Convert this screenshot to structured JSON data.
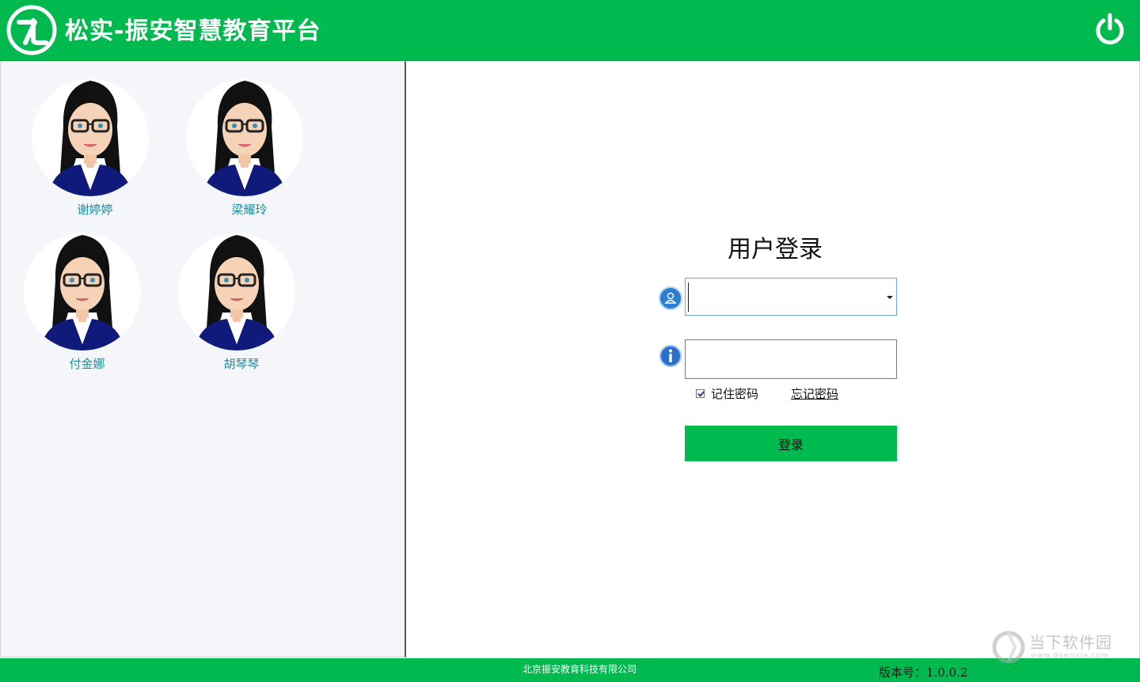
{
  "header": {
    "title": "松实-振安智慧教育平台",
    "brand_color": "#00b94f"
  },
  "users": [
    {
      "name": "谢婷婷",
      "avatar_icon": "female-teacher-avatar"
    },
    {
      "name": "梁耀玲",
      "avatar_icon": "female-teacher-avatar"
    },
    {
      "name": "付金娜",
      "avatar_icon": "female-teacher-avatar"
    },
    {
      "name": "胡琴琴",
      "avatar_icon": "female-teacher-avatar"
    }
  ],
  "login": {
    "title": "用户登录",
    "username_value": "",
    "password_value": "",
    "remember_label": "记住密码",
    "remember_checked": true,
    "forgot_label": "忘记密码",
    "submit_label": "登录"
  },
  "footer": {
    "company": "北京振安教育科技有限公司",
    "version": "版本号：1.0.0.2"
  },
  "watermark": {
    "text": "当下软件园",
    "sub": "www.downxia.com"
  }
}
